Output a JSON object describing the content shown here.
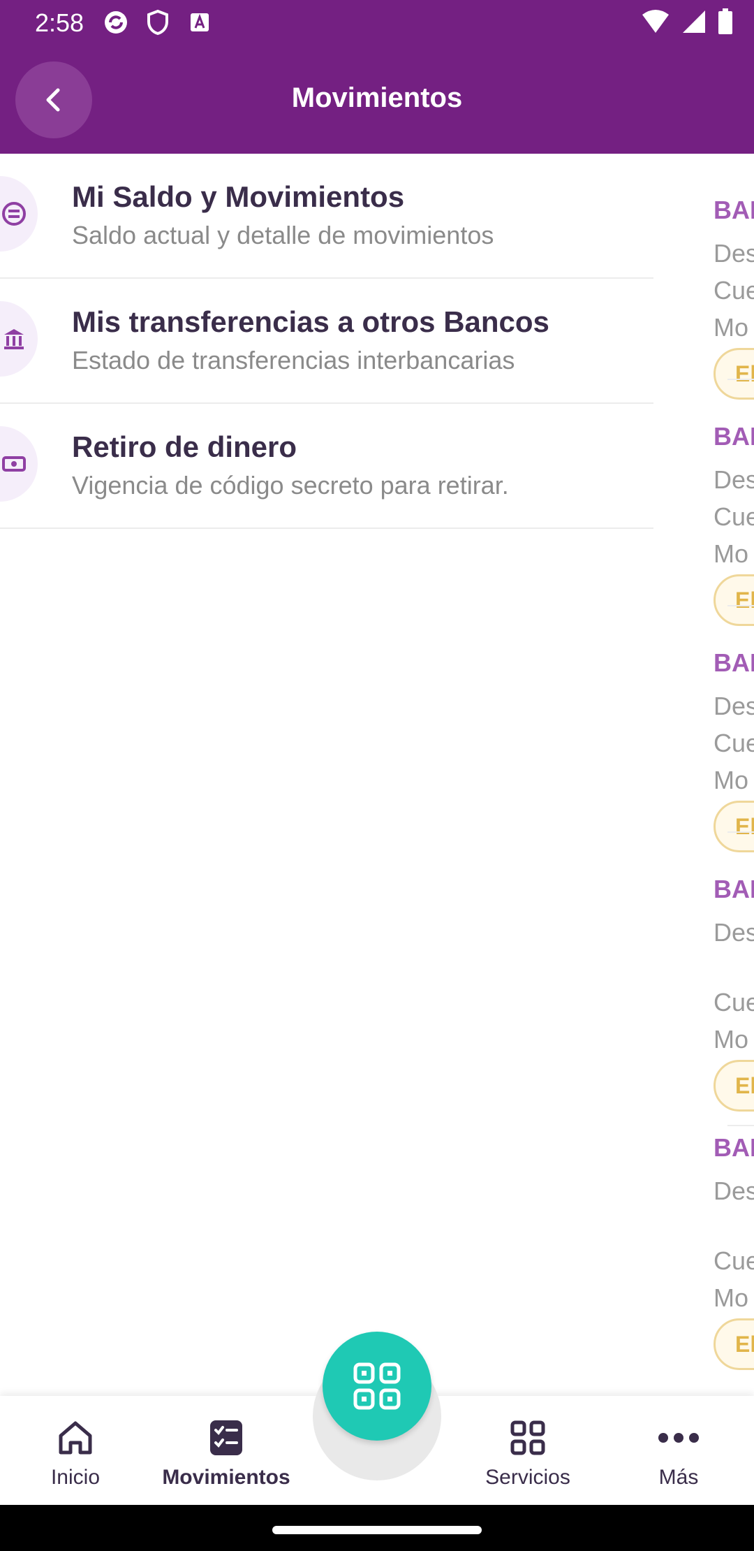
{
  "status_bar": {
    "time": "2:58",
    "icons_left": [
      "sync-icon",
      "shield-icon",
      "a-icon"
    ],
    "icons_right": [
      "wifi-icon",
      "signal-icon",
      "battery-icon"
    ]
  },
  "app_bar": {
    "title": "Movimientos"
  },
  "menu": {
    "items": [
      {
        "title": "Mi Saldo y Movimientos",
        "subtitle": "Saldo actual y detalle de movimientos",
        "icon": "list-icon"
      },
      {
        "title": "Mis transferencias a otros Bancos",
        "subtitle": "Estado de transferencias interbancarias",
        "icon": "bank-icon"
      },
      {
        "title": "Retiro de dinero",
        "subtitle": "Vigencia de código secreto para retirar.",
        "icon": "cash-icon"
      }
    ]
  },
  "peek": {
    "cards": [
      {
        "head": "BAI",
        "lines": [
          "Des",
          "Cue",
          "Mo"
        ],
        "pill": "El"
      },
      {
        "head": "BAI",
        "lines": [
          "Des",
          "Cue",
          "Mo"
        ],
        "pill": "El"
      },
      {
        "head": "BAI",
        "lines": [
          "Des",
          "Cue",
          "Mo"
        ],
        "pill": "El"
      },
      {
        "head": "BAI",
        "lines": [
          "Des",
          "Cue",
          "Mo"
        ],
        "pill": "El"
      },
      {
        "head": "BAI",
        "lines": [
          "Des",
          "Cue",
          "Mo"
        ],
        "pill": "El"
      }
    ]
  },
  "bottom_nav": {
    "items": [
      {
        "label": "Inicio",
        "icon": "home-icon"
      },
      {
        "label": "Movimientos",
        "icon": "checklist-icon",
        "active": true
      },
      {
        "label": "Servicios",
        "icon": "grid-icon"
      },
      {
        "label": "Más",
        "icon": "more-icon"
      }
    ],
    "fab_icon": "qr-grid-icon"
  },
  "colors": {
    "brand": "#742082",
    "accent": "#1fc9b4",
    "pill_border": "#efd79a"
  }
}
